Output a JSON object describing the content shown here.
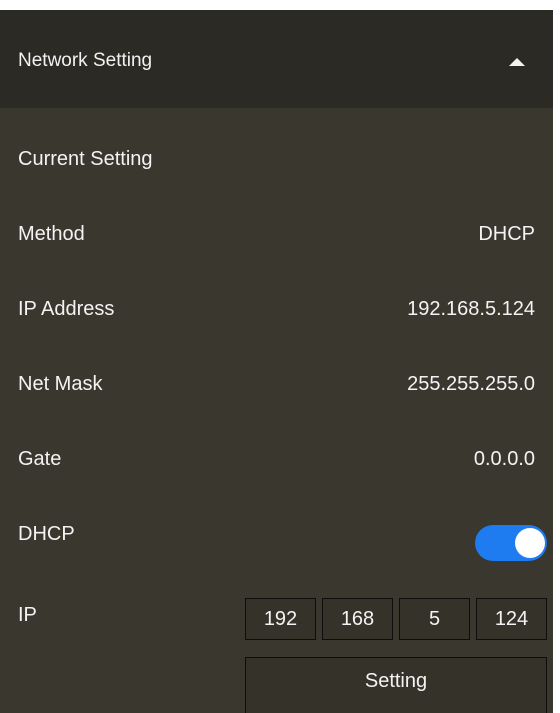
{
  "header": {
    "title": "Network Setting",
    "collapse_icon": "chevron-up-icon"
  },
  "current_setting": {
    "heading": "Current Setting",
    "rows": [
      {
        "label": "Method",
        "value": "DHCP"
      },
      {
        "label": "IP Address",
        "value": "192.168.5.124"
      },
      {
        "label": "Net Mask",
        "value": "255.255.255.0"
      },
      {
        "label": "Gate",
        "value": "0.0.0.0"
      }
    ]
  },
  "dhcp": {
    "label": "DHCP",
    "enabled": true,
    "toggle_color": "#1e7bf0"
  },
  "ip": {
    "label": "IP",
    "octets": [
      "192",
      "168",
      "5",
      "124"
    ]
  },
  "actions": {
    "setting_label": "Setting"
  },
  "colors": {
    "panel_bg": "#3a372f",
    "header_bg": "#2b2a24",
    "text": "#f3f3f3"
  }
}
